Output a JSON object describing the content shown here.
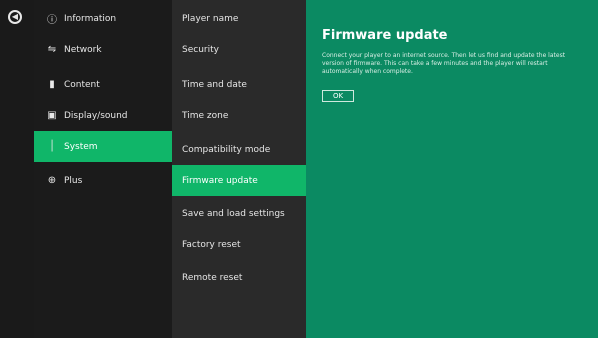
{
  "main_menu": [
    {
      "label": "Information",
      "icon": "info-icon"
    },
    {
      "label": "Network",
      "icon": "network-icon"
    },
    {
      "label": "Content",
      "icon": "folder-icon"
    },
    {
      "label": "Display/sound",
      "icon": "monitor-icon"
    },
    {
      "label": "System",
      "icon": "system-icon"
    },
    {
      "label": "Plus",
      "icon": "plus-icon"
    }
  ],
  "sub_menu": [
    {
      "label": "Player name"
    },
    {
      "label": "Security"
    },
    {
      "label": "Time and date"
    },
    {
      "label": "Time zone"
    },
    {
      "label": "Compatibility mode"
    },
    {
      "label": "Firmware update"
    },
    {
      "label": "Save and load settings"
    },
    {
      "label": "Factory reset"
    },
    {
      "label": "Remote reset"
    }
  ],
  "content": {
    "title": "Firmware update",
    "description": "Connect your player to an internet source. Then let us find and update the latest version of firmware. This can take a few minutes and the player will restart automatically when complete.",
    "ok_label": "OK"
  },
  "colors": {
    "selected": "#10b669",
    "content_bg": "#0b8a62"
  }
}
